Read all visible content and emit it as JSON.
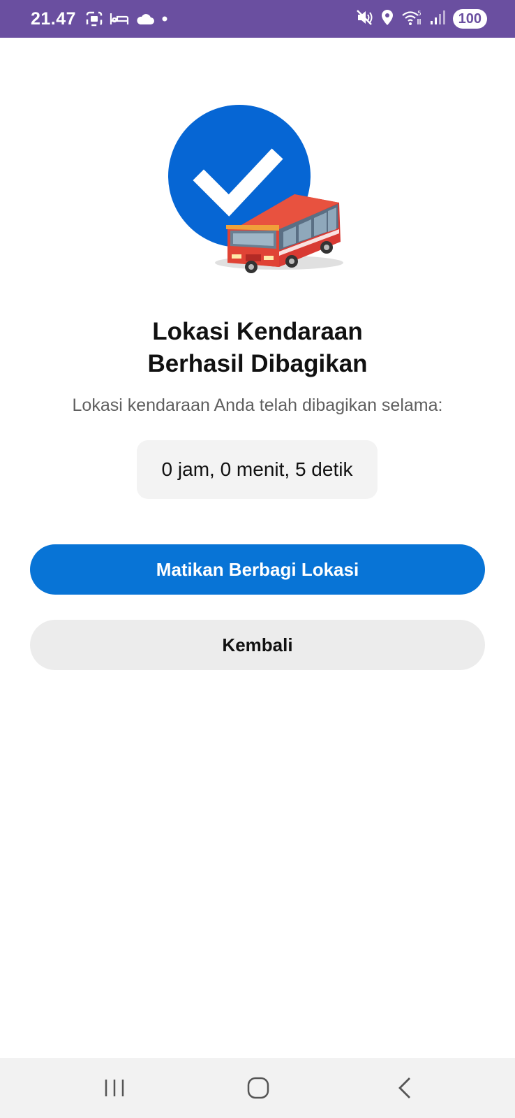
{
  "status_bar": {
    "time": "21.47",
    "battery": "100",
    "left_icons": [
      "screenshot-icon",
      "bed-icon",
      "cloud-icon",
      "dot-icon"
    ],
    "right_icons": [
      "mute-icon",
      "location-pin-icon",
      "wifi-icon",
      "signal-icon"
    ]
  },
  "hero": {
    "check_color": "#0666d4",
    "bus_color": "#e03a32"
  },
  "main": {
    "title_line1": "Lokasi Kendaraan",
    "title_line2": "Berhasil Dibagikan",
    "subtitle": "Lokasi kendaraan Anda telah dibagikan selama:",
    "duration": "0 jam, 0 menit, 5 detik"
  },
  "buttons": {
    "stop_sharing": "Matikan Berbagi Lokasi",
    "back": "Kembali"
  },
  "nav": {
    "items": [
      "recent-apps-icon",
      "home-icon",
      "back-icon"
    ]
  },
  "colors": {
    "status_bar": "#6a4fa0",
    "primary_button": "#0874d6",
    "secondary_button": "#ececec"
  }
}
